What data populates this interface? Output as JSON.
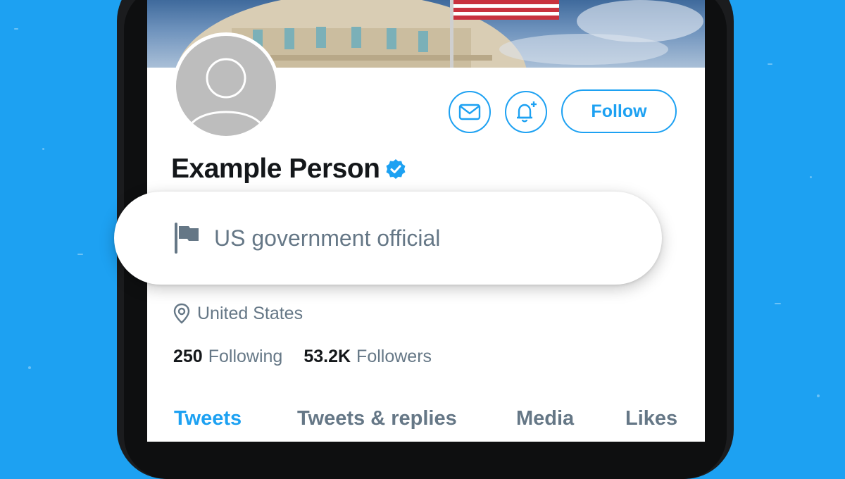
{
  "profile": {
    "name": "Example Person",
    "label": "US government official",
    "location": "United States",
    "following_count": "250",
    "following_label": "Following",
    "followers_count": "53.2K",
    "followers_label": "Followers"
  },
  "actions": {
    "follow_label": "Follow"
  },
  "tabs": [
    {
      "label": "Tweets",
      "active": true
    },
    {
      "label": "Tweets & replies",
      "active": false
    },
    {
      "label": "Media",
      "active": false
    },
    {
      "label": "Likes",
      "active": false
    }
  ],
  "colors": {
    "accent": "#1da1f2",
    "text_primary": "#14171a",
    "text_secondary": "#657786",
    "background": "#1da1f2"
  },
  "icons": {
    "message": "envelope-icon",
    "notifications": "bell-plus-icon",
    "verified": "verified-badge-icon",
    "label": "flag-icon",
    "location": "location-pin-icon"
  }
}
